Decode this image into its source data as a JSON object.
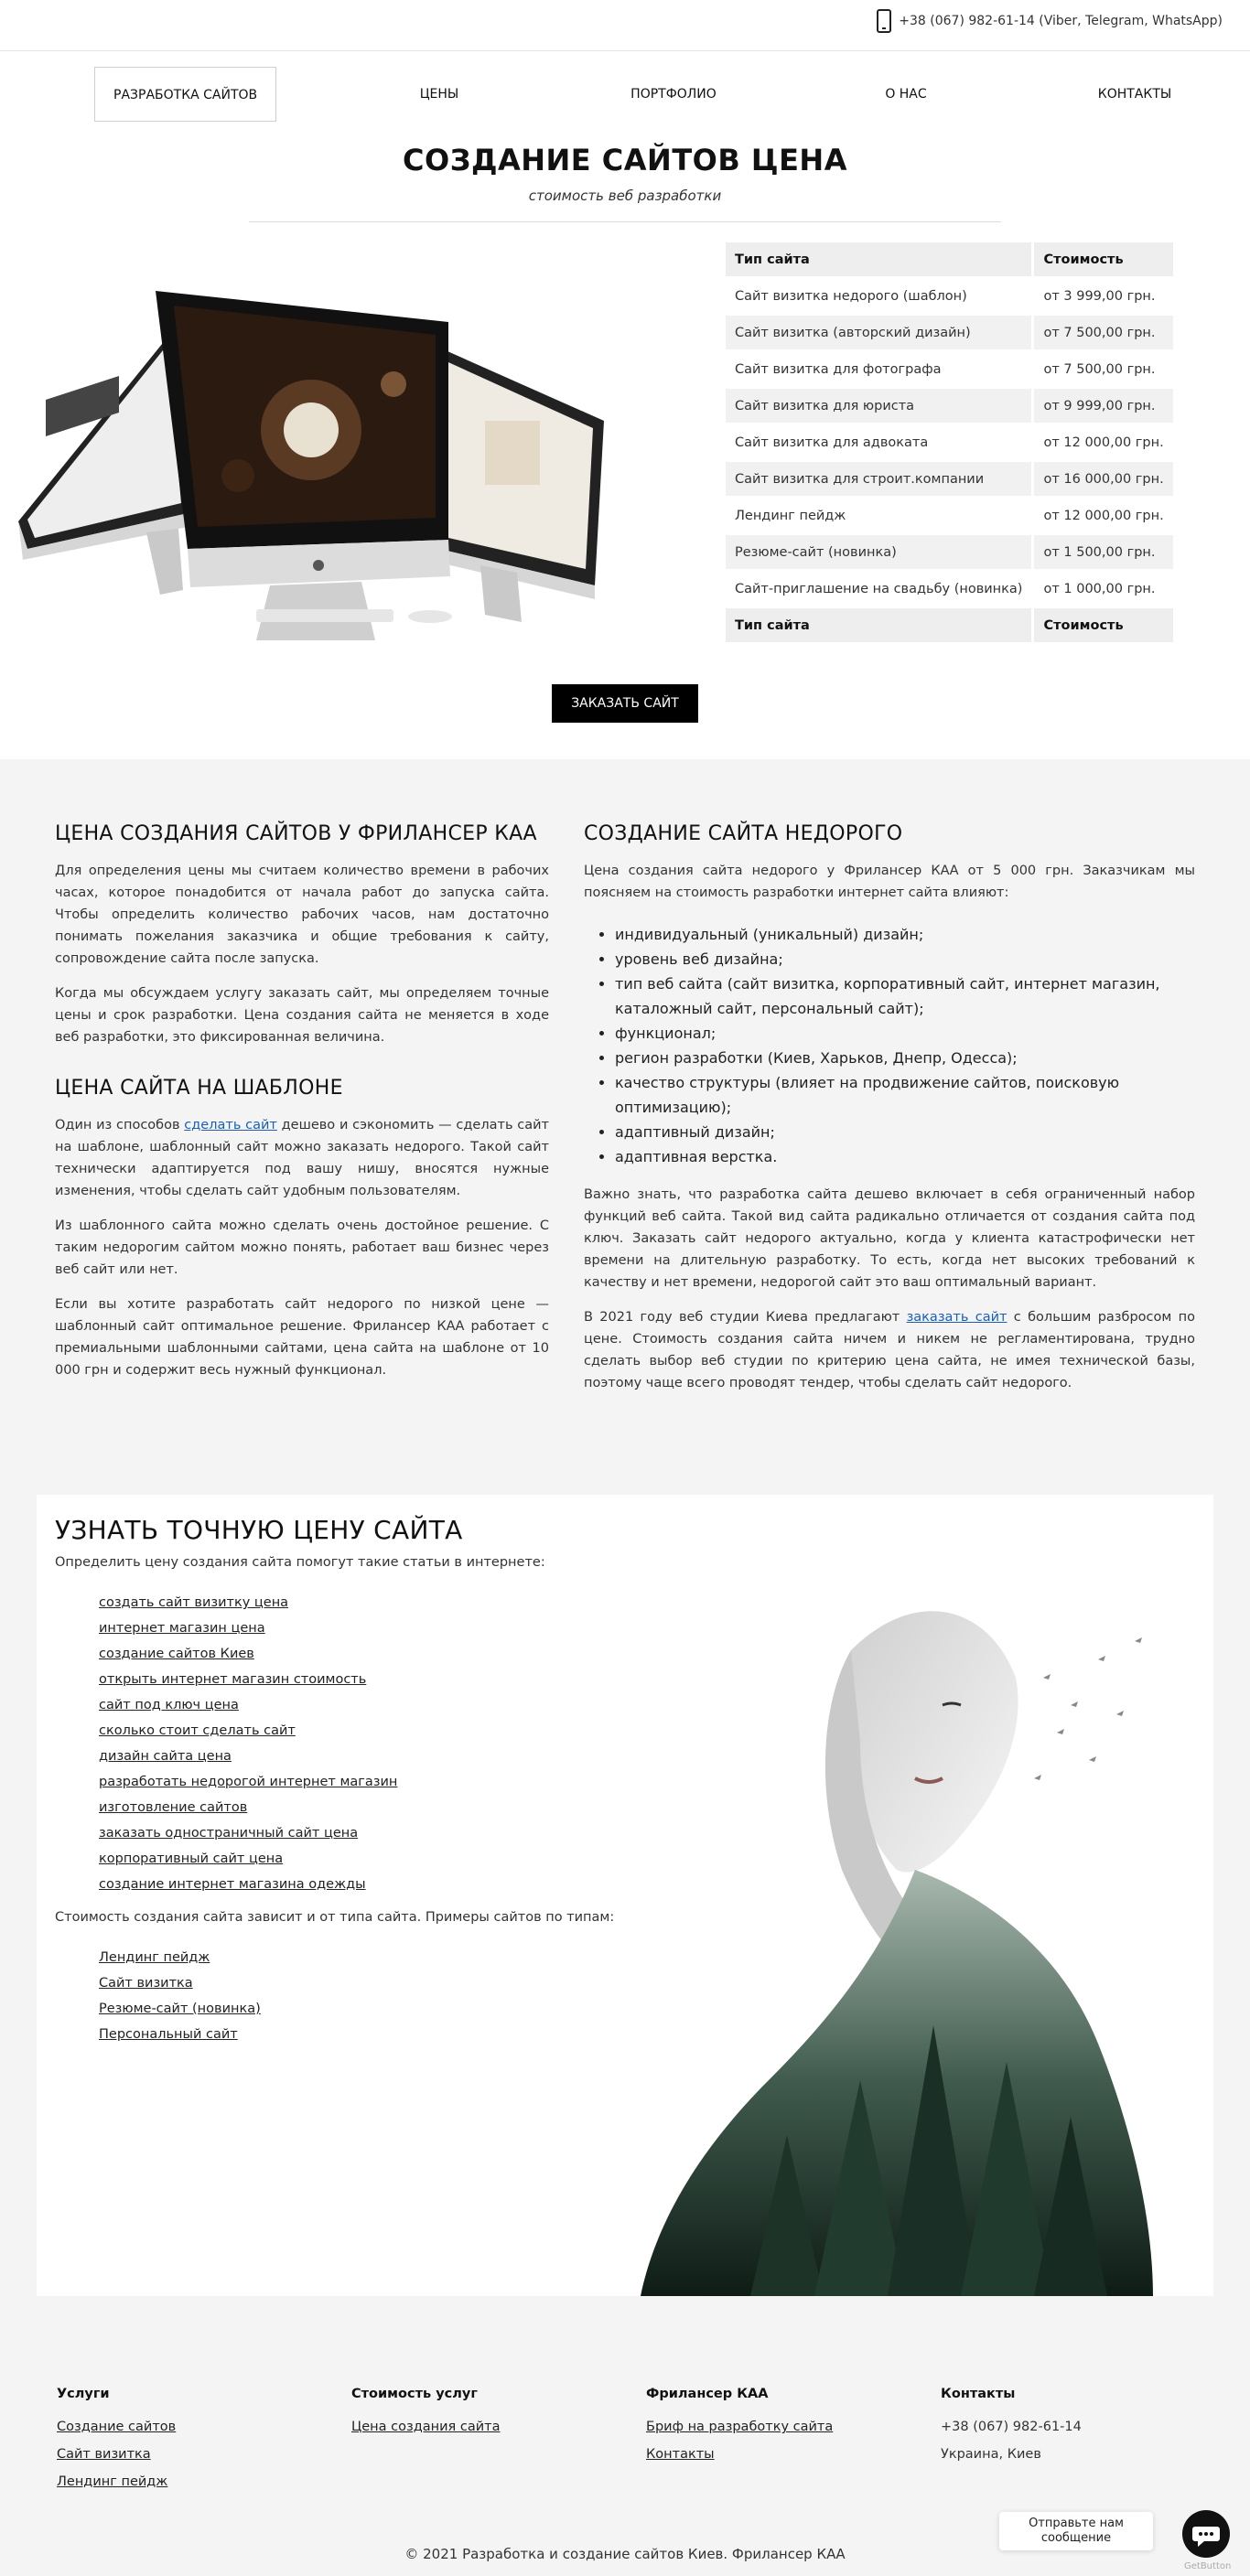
{
  "topbar": {
    "phone": "+38 (067) 982-61-14 (Viber, Telegram, WhatsApp)"
  },
  "nav": {
    "items": [
      {
        "label": "РАЗРАБОТКА САЙТОВ"
      },
      {
        "label": "ЦЕНЫ"
      },
      {
        "label": "ПОРТФОЛИО"
      },
      {
        "label": "О НАС"
      },
      {
        "label": "КОНТАКТЫ"
      }
    ]
  },
  "hero": {
    "title": "СОЗДАНИЕ САЙТОВ ЦЕНА",
    "subtitle": "стоимость веб разработки"
  },
  "price_table": {
    "header": {
      "type": "Тип сайта",
      "cost": "Стоимость"
    },
    "rows": [
      {
        "type": "Сайт визитка недорого (шаблон)",
        "cost": "от 3 999,00 грн."
      },
      {
        "type": "Сайт визитка (авторский дизайн)",
        "cost": "от 7 500,00 грн."
      },
      {
        "type": "Сайт визитка для фотографа",
        "cost": "от 7 500,00 грн."
      },
      {
        "type": "Сайт визитка для юриста",
        "cost": "от 9 999,00 грн."
      },
      {
        "type": "Сайт визитка для адвоката",
        "cost": "от 12 000,00 грн."
      },
      {
        "type": "Сайт визитка для строит.компании",
        "cost": "от 16 000,00 грн."
      },
      {
        "type": "Лендинг пейдж",
        "cost": "от 12 000,00 грн."
      },
      {
        "type": "Резюме-сайт (новинка)",
        "cost": "от 1 500,00 грн."
      },
      {
        "type": "Сайт-приглашение на свадьбу (новинка)",
        "cost": "от 1 000,00 грн."
      }
    ],
    "footer": {
      "type": "Тип сайта",
      "cost": "Стоимость"
    }
  },
  "order_button": "ЗАКАЗАТЬ САЙТ",
  "left_col": {
    "h1": "ЦЕНА СОЗДАНИЯ САЙТОВ У ФРИЛАНСЕР КАА",
    "p1": "Для определения цены мы считаем количество времени в рабочих часах, которое понадобится от начала работ до запуска сайта. Чтобы определить количество рабочих часов, нам достаточно понимать пожелания заказчика и общие требования к сайту, сопровождение сайта после запуска.",
    "p2": "Когда мы обсуждаем услугу заказать сайт, мы определяем точные цены и срок разработки. Цена создания сайта не меняется в ходе веб разработки, это фиксированная величина.",
    "h2": "ЦЕНА САЙТА НА ШАБЛОНЕ",
    "p3_before": "Один из способов ",
    "p3_link": "сделать сайт",
    "p3_after": " дешево и сэкономить — сделать сайт на шаблоне, шаблонный сайт можно заказать недорого. Такой сайт технически адаптируется под вашу нишу, вносятся нужные изменения, чтобы сделать сайт удобным пользователям.",
    "p4": "Из шаблонного сайта можно сделать очень достойное решение. С таким недорогим сайтом можно понять, работает ваш бизнес через веб сайт или нет.",
    "p5": "Если вы хотите разработать сайт недорого по низкой цене — шаблонный сайт оптимальное решение. Фрилансер КАА работает с премиальными шаблонными сайтами, цена сайта на шаблоне от 10 000 грн и содержит весь нужный функционал."
  },
  "right_col": {
    "h1": "СОЗДАНИЕ САЙТА НЕДОРОГО",
    "p1": "Цена создания сайта недорого у Фрилансер КАА от 5 000 грн. Заказчикам мы поясняем на стоимость разработки интернет сайта влияют:",
    "list": [
      "индивидуальный (уникальный) дизайн;",
      "уровень веб дизайна;",
      "тип веб сайта (сайт визитка, корпоративный сайт, интернет магазин, каталожный сайт, персональный сайт);",
      "функционал;",
      "регион разработки (Киев, Харьков, Днепр, Одесса);",
      "качество структуры (влияет на продвижение сайтов, поисковую оптимизацию);",
      "адаптивный дизайн;",
      "адаптивная верстка."
    ],
    "p2": "Важно знать, что разработка сайта дешево включает в себя ограниченный набор функций веб сайта. Такой вид сайта радикально отличается от создания сайта под ключ. Заказать сайт недорого актуально, когда у клиента катастрофически нет времени на длительную разработку. То есть, когда нет высоких требований к качеству и нет времени, недорогой сайт это ваш оптимальный вариант.",
    "p3_before": "В 2021 году веб студии Киева предлагают ",
    "p3_link": "заказать сайт",
    "p3_after": " с большим разбросом по цене. Стоимость создания сайта ничем и никем не регламентирована, трудно сделать выбор веб студии по критерию цена сайта, не имея технической базы, поэтому чаще всего проводят тендер, чтобы сделать сайт недорого."
  },
  "price_card": {
    "title": "УЗНАТЬ ТОЧНУЮ ЦЕНУ САЙТА",
    "intro": "Определить цену создания сайта помогут такие статьи в интернете:",
    "links": [
      "создать сайт визитку цена",
      "интернет магазин цена",
      "создание сайтов Киев",
      "открыть интернет магазин стоимость",
      "сайт под ключ цена",
      "сколько стоит сделать сайт",
      "дизайн сайта цена",
      "разработать недорогой интернет магазин",
      "изготовление сайтов",
      "заказать одностраничный сайт цена",
      "корпоративный сайт цена",
      "создание интернет магазина одежды"
    ],
    "intro2": "Стоимость создания сайта зависит и от типа сайта. Примеры сайтов по типам:",
    "links2": [
      "Лендинг пейдж",
      "Сайт визитка",
      "Резюме-сайт (новинка)",
      "Персональный сайт"
    ]
  },
  "footer": {
    "cols": [
      {
        "heading": "Услуги",
        "links": [
          "Создание сайтов",
          "Сайт визитка",
          "Лендинг пейдж"
        ]
      },
      {
        "heading": "Стоимость услуг",
        "links": [
          "Цена создания сайта"
        ]
      },
      {
        "heading": "Фрилансер КАА",
        "links": [
          "Бриф на разработку сайта",
          "Контакты"
        ]
      },
      {
        "heading": "Контакты",
        "phone": "+38 (067) 982-61-14",
        "city": "Украина, Киев"
      }
    ],
    "copyright": "© 2021 Разработка и создание сайтов Киев. Фрилансер КАА"
  },
  "chat": {
    "label": "Отправьте нам сообщение",
    "credit": "GetButton"
  }
}
